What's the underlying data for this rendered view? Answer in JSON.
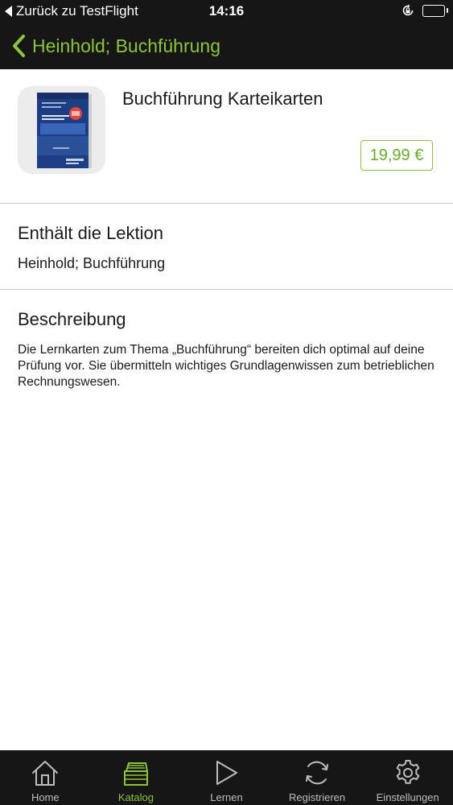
{
  "status_bar": {
    "back_label": "Zurück zu TestFlight",
    "time": "14:16",
    "lock_icon": "rotation-lock-icon",
    "battery_icon": "battery-icon"
  },
  "nav": {
    "back_icon": "chevron-left-icon",
    "title": "Heinhold; Buchführung",
    "accent_color": "#8bc53f"
  },
  "product": {
    "title": "Buchführung Karteikarten",
    "price": "19,99 €"
  },
  "lesson_section": {
    "heading": "Enthält die Lektion",
    "value": "Heinhold; Buchführung"
  },
  "description_section": {
    "heading": "Beschreibung",
    "text": "Die Lernkarten zum Thema „Buchführung“ bereiten dich optimal auf deine Prüfung vor. Sie übermitteln wichtiges Grundlagenwissen zum betrieblichen Rechnungswesen."
  },
  "tab_bar": {
    "active_color": "#8bc53f",
    "items": [
      {
        "label": "Home",
        "icon": "house-icon",
        "active": false
      },
      {
        "label": "Katalog",
        "icon": "books-icon",
        "active": true
      },
      {
        "label": "Lernen",
        "icon": "play-icon",
        "active": false
      },
      {
        "label": "Registrieren",
        "icon": "refresh-icon",
        "active": false
      },
      {
        "label": "Einstellungen",
        "icon": "gear-icon",
        "active": false
      }
    ]
  }
}
